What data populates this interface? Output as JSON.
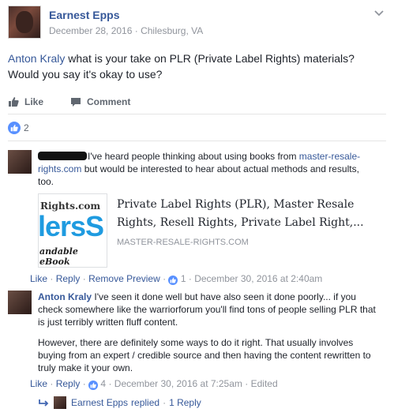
{
  "post": {
    "author": "Earnest Epps",
    "date": "December 28, 2016",
    "location": "Chilesburg, VA",
    "mention": "Anton Kraly",
    "text": " what is your take on PLR (Private Label Rights) materials? Would you say it's okay to use?"
  },
  "actions": {
    "like": "Like",
    "comment": "Comment"
  },
  "reactions": {
    "count": "2"
  },
  "comments": [
    {
      "text_start": "I've heard people thinking about using books from ",
      "link": "master-resale-rights.com",
      "text_end": " but would be interested to hear about actual methods and results, too.",
      "preview": {
        "thumb_line1": "Rights.com",
        "thumb_line2": "lersS",
        "thumb_line3": "andable eBook",
        "title": "Private Label Rights (PLR), Master Resale Rights, Resell Rights, Private Label Right,...",
        "domain": "MASTER-RESALE-RIGHTS.COM"
      },
      "actions": {
        "like": "Like",
        "reply": "Reply",
        "remove_preview": "Remove Preview",
        "count": "1",
        "time": "December 30, 2016 at 2:40am"
      }
    },
    {
      "author": "Anton Kraly",
      "para1": "I've seen it done well but have also seen it done poorly... if you check somewhere like the warriorforum you'll find tons of people selling PLR that is just terribly written fluff content.",
      "para2": "However, there are definitely some ways to do it right. That usually involves buying from an expert / credible source and then having the content rewritten to truly make it your own.",
      "actions": {
        "like": "Like",
        "reply": "Reply",
        "count": "4",
        "time": "December 30, 2016 at 7:25am",
        "edited": "Edited"
      }
    }
  ],
  "reply_summary": {
    "author": "Earnest Epps",
    "verb": "replied",
    "count_label": "1 Reply"
  }
}
